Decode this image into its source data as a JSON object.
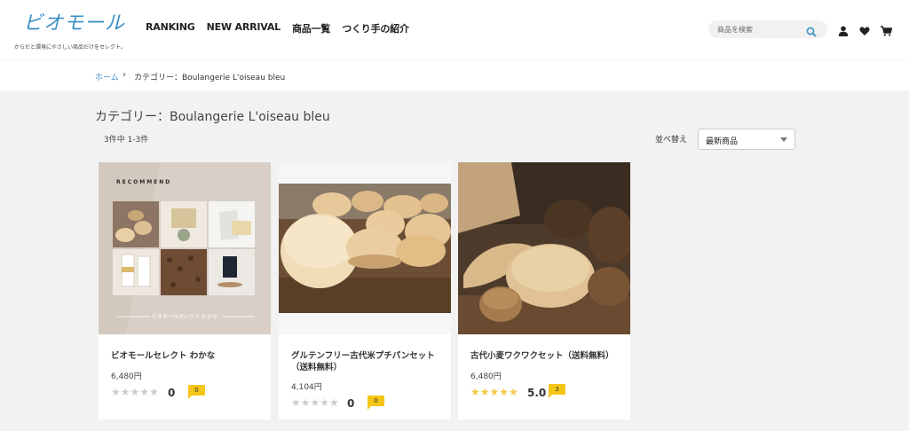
{
  "header": {
    "logo_text": "ビオモール",
    "tagline": "からだと環境にやさしい商品だけをセレクト。",
    "nav": [
      "RANKING",
      "NEW ARRIVAL",
      "商品一覧",
      "つくり手の紹介"
    ],
    "search_placeholder": "商品を検索",
    "icons": [
      "search-icon",
      "user-icon",
      "heart-icon",
      "cart-icon"
    ]
  },
  "breadcrumb": {
    "home": "ホーム",
    "separator": "›",
    "current": "カテゴリー：Boulangerie L'oiseau bleu"
  },
  "listing": {
    "title": "カテゴリー：Boulangerie L'oiseau bleu",
    "count": "3件中 1-3件",
    "sort_label": "並べ替え",
    "sort_value": "最新商品"
  },
  "products": [
    {
      "name": "ビオモールセレクト わかな",
      "price": "6,480円",
      "stars": "★★★★★",
      "rating": "0",
      "reviews": "0",
      "image_top_text": "RECOMMEND",
      "image_bottom_text": "ビオモールセレクト わかな"
    },
    {
      "name": "グルテンフリー古代米プチパンセット（送料無料）",
      "price": "4,104円",
      "stars": "★★★★★",
      "rating": "0",
      "reviews": "0"
    },
    {
      "name": "古代小麦ワクワクセット（送料無料）",
      "price": "6,480円",
      "stars": "★★★★★",
      "rating": "5.0",
      "reviews": "3"
    }
  ],
  "colors": {
    "accent": "#3b8fc4",
    "star": "#f2c94c",
    "badge": "#f5c518",
    "background": "#f2f2f2"
  }
}
